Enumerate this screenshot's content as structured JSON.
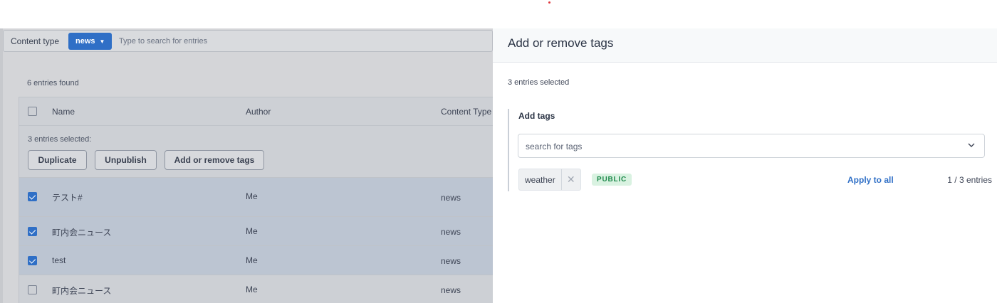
{
  "search": {
    "content_type_label": "Content type",
    "content_type_value": "news",
    "placeholder": "Type to search for entries"
  },
  "list": {
    "found_text": "6 entries found",
    "columns": [
      "Name",
      "Author",
      "Content Type"
    ],
    "selected_text": "3 entries selected:",
    "actions": {
      "duplicate": "Duplicate",
      "unpublish": "Unpublish",
      "tags": "Add or remove tags"
    },
    "rows": [
      {
        "name": "テスト#",
        "author": "Me",
        "content_type": "news",
        "checked": true
      },
      {
        "name": "町内会ニュース",
        "author": "Me",
        "content_type": "news",
        "checked": true
      },
      {
        "name": "test",
        "author": "Me",
        "content_type": "news",
        "checked": true
      },
      {
        "name": "町内会ニュース",
        "author": "Me",
        "content_type": "news",
        "checked": false
      }
    ]
  },
  "panel": {
    "title": "Add or remove tags",
    "selected_text": "3 entries selected",
    "add_tags_label": "Add tags",
    "tag_search_placeholder": "search for tags",
    "tag": {
      "label": "weather",
      "visibility": "PUBLIC",
      "apply_label": "Apply to all",
      "count": "1 / 3 entries"
    }
  },
  "colors": {
    "accent": "#2f6fc6",
    "public_bg": "#d9f2e1",
    "public_text": "#1f8a4c"
  }
}
